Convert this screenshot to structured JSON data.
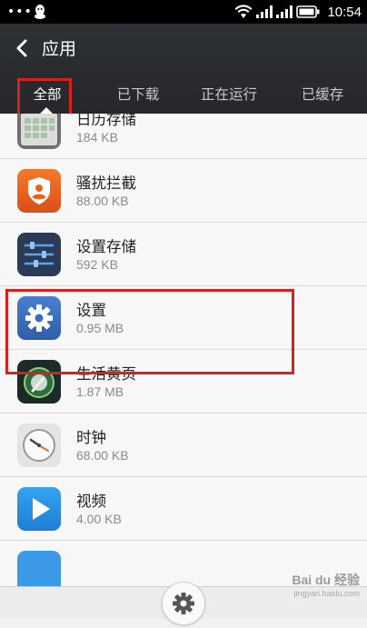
{
  "status_bar": {
    "time": "10:54",
    "icons": [
      "more-dots-icon",
      "qq-icon",
      "wifi-icon",
      "signal-icon",
      "signal-icon-2",
      "battery-icon"
    ]
  },
  "header": {
    "title": "应用",
    "back_icon": "chevron-left-icon"
  },
  "tabs": [
    {
      "label": "全部",
      "active": true
    },
    {
      "label": "已下载",
      "active": false
    },
    {
      "label": "正在运行",
      "active": false
    },
    {
      "label": "已缓存",
      "active": false
    }
  ],
  "apps": [
    {
      "name": "日历存储",
      "size": "184 KB",
      "icon": "calendar-storage-icon"
    },
    {
      "name": "骚扰拦截",
      "size": "88.00 KB",
      "icon": "shield-person-icon"
    },
    {
      "name": "设置存储",
      "size": "592 KB",
      "icon": "sliders-icon"
    },
    {
      "name": "设置",
      "size": "0.95 MB",
      "icon": "settings-gear-icon"
    },
    {
      "name": "生活黄页",
      "size": "1.87 MB",
      "icon": "yellow-pages-icon"
    },
    {
      "name": "时钟",
      "size": "68.00 KB",
      "icon": "clock-icon"
    },
    {
      "name": "视频",
      "size": "4.00 KB",
      "icon": "video-play-icon"
    }
  ],
  "bottom_bar": {
    "settings_icon": "gear-icon"
  },
  "watermark": {
    "text": "Bai du 经验",
    "sub": "jingyan.baidu.com"
  },
  "colors": {
    "highlight": "#d8211e",
    "header_bg": "#2b2e32",
    "accent_blue": "#3a6fb8"
  }
}
